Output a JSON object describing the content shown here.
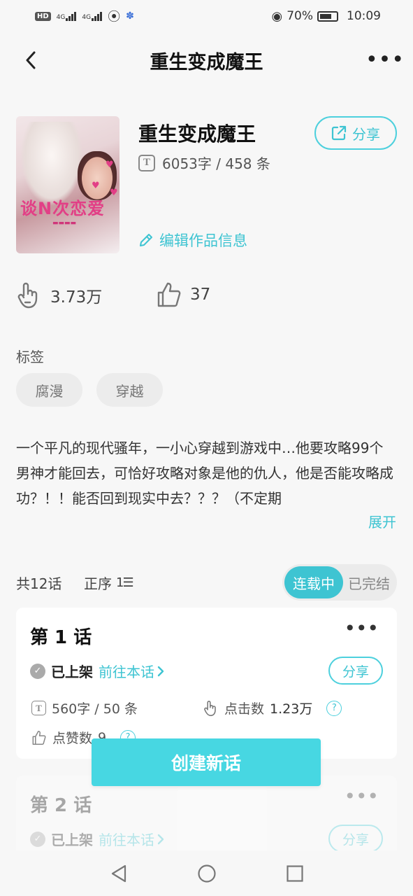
{
  "status_bar": {
    "hd_label": "HD",
    "net1": "4G",
    "net2": "4G",
    "battery_pct": "70%",
    "time": "10:09"
  },
  "header": {
    "title": "重生变成魔王"
  },
  "book": {
    "title": "重生变成魔王",
    "word_count": "6053字 / 458 条",
    "share_label": "分享",
    "edit_label": "编辑作品信息",
    "cover_text": "谈N次恋爱"
  },
  "stats": {
    "clicks": "3.73万",
    "likes": "37"
  },
  "tags": {
    "label": "标签",
    "items": [
      "腐漫",
      "穿越"
    ]
  },
  "summary": {
    "text": "一个平凡的现代骚年，一小心穿越到游戏中…他要攻略99个男神才能回去，可恰好攻略对象是他的仇人，他是否能攻略成功？！！能否回到现实中去？？？（不定期",
    "expand_label": "展开"
  },
  "episodes_header": {
    "count": "共12话",
    "order_label": "正序",
    "tabs": [
      "连载中",
      "已完结"
    ]
  },
  "episodes": [
    {
      "title": "第 1 话",
      "status": "已上架",
      "goto_label": "前往本话",
      "share_label": "分享",
      "words": "560字 / 50 条",
      "clicks_label": "点击数",
      "clicks_value": "1.23万",
      "likes_label": "点赞数",
      "likes_value": "9"
    },
    {
      "title": "第 2 话",
      "status": "已上架",
      "goto_label": "前往本话",
      "share_label": "分享"
    }
  ],
  "create_button": "创建新话",
  "colors": {
    "accent": "#3ec4d2",
    "button": "#47d7e2"
  }
}
